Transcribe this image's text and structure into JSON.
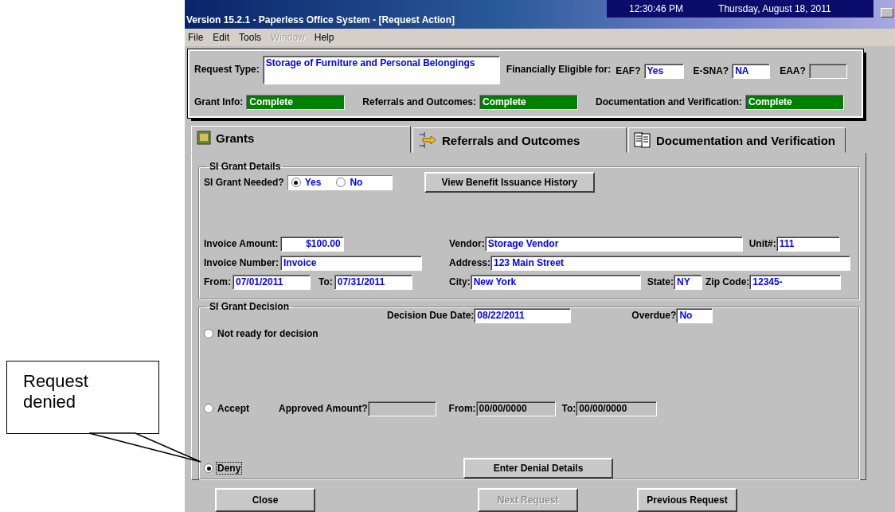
{
  "window": {
    "title": "Version 15.2.1 - Paperless Office System - [Request Action]",
    "time": "12:30:46 PM",
    "date": "Thursday, August 18, 2011"
  },
  "menu": [
    {
      "label": "File",
      "disabled": false
    },
    {
      "label": "Edit",
      "disabled": false
    },
    {
      "label": "Tools",
      "disabled": false
    },
    {
      "label": "Window",
      "disabled": true
    },
    {
      "label": "Help",
      "disabled": false
    }
  ],
  "header": {
    "request_type": {
      "label": "Request Type:",
      "value": "Storage of Furniture and Personal Belongings"
    },
    "eligible_label": "Financially Eligible for:",
    "eligibility": [
      {
        "label": "EAF?",
        "value": "Yes",
        "disabled": false
      },
      {
        "label": "E-SNA?",
        "value": "NA",
        "disabled": false
      },
      {
        "label": "EAA?",
        "disabled": true
      }
    ],
    "statuses": [
      {
        "label": "Grant Info:",
        "value": "Complete"
      },
      {
        "label": "Referrals and Outcomes:",
        "value": "Complete"
      },
      {
        "label": "Documentation and Verification:",
        "value": "Complete"
      }
    ]
  },
  "tabs": [
    {
      "label": "Grants",
      "selected": true
    },
    {
      "label": "Referrals and Outcomes",
      "selected": false
    },
    {
      "label": "Documentation and Verification",
      "selected": false
    }
  ],
  "grant_details": {
    "legend": "SI Grant Details",
    "needed_label": "SI Grant Needed?",
    "needed_options": [
      {
        "label": "Yes",
        "selected": true
      },
      {
        "label": "No",
        "selected": false
      }
    ],
    "history_button": "View Benefit Issuance History",
    "invoice_amount": {
      "label": "Invoice Amount:",
      "value": "$100.00"
    },
    "vendor": {
      "label": "Vendor:",
      "value": "Storage Vendor"
    },
    "unit": {
      "label": "Unit#:",
      "value": "111"
    },
    "invoice_number": {
      "label": "Invoice Number:",
      "value": "Invoice"
    },
    "address": {
      "label": "Address:",
      "value": "123 Main Street"
    },
    "from": {
      "label": "From:",
      "value": "07/01/2011"
    },
    "to": {
      "label": "To:",
      "value": "07/31/2011"
    },
    "city": {
      "label": "City:",
      "value": "New York"
    },
    "state": {
      "label": "State:",
      "value": "NY"
    },
    "zip": {
      "label": "Zip Code:",
      "value": "12345-"
    }
  },
  "decision": {
    "legend": "SI Grant Decision",
    "due_date": {
      "label": "Decision Due Date:",
      "value": "08/22/2011"
    },
    "overdue": {
      "label": "Overdue?",
      "value": "No"
    },
    "options": [
      {
        "kind": "plain",
        "label": "Not ready for decision",
        "selected": false,
        "focused": false
      },
      {
        "kind": "accept",
        "label": "Accept",
        "selected": false,
        "focused": false
      },
      {
        "kind": "deny",
        "label": "Deny",
        "selected": true,
        "focused": true
      }
    ],
    "approved_amount": {
      "label": "Approved Amount?",
      "disabled": true
    },
    "from": {
      "label": "From:",
      "value": "00/00/0000",
      "disabled": true
    },
    "to": {
      "label": "To:",
      "value": "00/00/0000",
      "disabled": true
    },
    "denial_button": "Enter Denial Details"
  },
  "buttons": [
    {
      "label": "Close",
      "disabled": false
    },
    {
      "label": "Next Request",
      "disabled": true
    },
    {
      "label": "Previous Request",
      "disabled": false
    }
  ],
  "callout": {
    "text": "Request denied"
  }
}
